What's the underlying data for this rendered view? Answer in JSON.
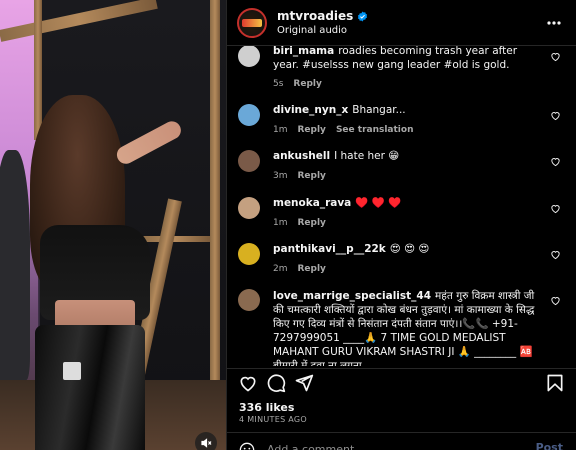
{
  "header": {
    "username": "mtvroadies",
    "subtitle": "Original audio",
    "more_icon": "more-horizontal-icon"
  },
  "comments": [
    {
      "username": "biri_mama",
      "text": "roadies becoming trash year after year. #uselsss new gang leader #old is gold.",
      "time": "5s",
      "reply": "Reply",
      "extra": "",
      "avatar_color": "#cfcfcf"
    },
    {
      "username": "divine_nyn_x",
      "text": "Bhangar...",
      "time": "1m",
      "reply": "Reply",
      "extra": "See translation",
      "avatar_color": "#6aa8d8"
    },
    {
      "username": "ankushell",
      "text": "I hate her 😁",
      "time": "3m",
      "reply": "Reply",
      "extra": "",
      "avatar_color": "#7a5a48"
    },
    {
      "username": "menoka_rava",
      "text": "♥️ ♥️ ♥️",
      "time": "1m",
      "reply": "Reply",
      "extra": "",
      "avatar_color": "#c4a080"
    },
    {
      "username": "panthikavi__p__22k",
      "text": "😍 😍 😍",
      "time": "2m",
      "reply": "Reply",
      "extra": "",
      "avatar_color": "#d8b020"
    },
    {
      "username": "love_marrige_specialist_44",
      "text": "महंत गुरु विक्रम शास्त्री जी की चमत्कारी शक्तियों द्वारा कोख बंधन तुड़वाएं। मां कामाख्या के सिद्ध किए गए दिव्य मंत्रों से निसंतान दंपती संतान पाएं।।📞📞 +91-7297999051 ____🙏 7 TIME GOLD MEDALIST MAHANT GURU VIKRAM SHASTRI JI 🙏 ________ 🆎 बीमारी में दवा ना लगना",
      "time": "",
      "reply": "",
      "extra": "",
      "avatar_color": "#8a6a50"
    }
  ],
  "actions": {
    "like_icon": "heart-outline-icon",
    "comment_icon": "comment-icon",
    "share_icon": "send-icon",
    "save_icon": "bookmark-icon"
  },
  "likes": "336 likes",
  "posted_time": "4 MINUTES AGO",
  "add_comment": {
    "placeholder": "Add a comment...",
    "post_label": "Post"
  },
  "colors": {
    "background": "#000000",
    "text": "#f5f5f5",
    "secondary_text": "#a8a8a8",
    "verified_blue": "#0095f6",
    "divider": "#262626",
    "post_disabled": "#4a5d86"
  }
}
